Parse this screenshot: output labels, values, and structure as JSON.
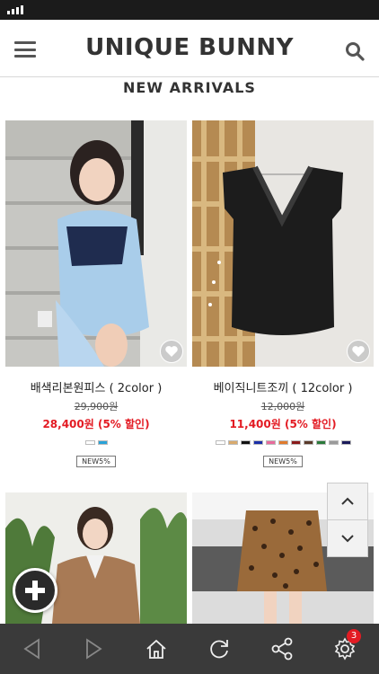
{
  "header": {
    "brand": "UNIQUE BUNNY"
  },
  "section": {
    "title": "NEW ARRIVALS"
  },
  "products": [
    {
      "name": "배색리본원피스 ( 2color )",
      "old_price": "29,900원",
      "new_price": "28,400원 (5% 할인)",
      "badge": "NEW5%",
      "swatches": [
        "#ffffff",
        "#29a3d8"
      ]
    },
    {
      "name": "베이직니트조끼 ( 12color )",
      "old_price": "12,000원",
      "new_price": "11,400원 (5% 할인)",
      "badge": "NEW5%",
      "swatches": [
        "#ffffff",
        "#d9ab6e",
        "#111111",
        "#1a2fa8",
        "#e86b9c",
        "#e07b2e",
        "#8a1a1a",
        "#5a3a2a",
        "#2a7a3a",
        "#9a9a9a",
        "#1a1a5a"
      ]
    },
    {
      "name": "",
      "old_price": "",
      "new_price": "",
      "badge": ""
    },
    {
      "name": "",
      "old_price": "",
      "new_price": "",
      "badge": ""
    }
  ],
  "bottom_bar": {
    "notification_count": "3"
  },
  "colors": {
    "sale_red": "#e31b23",
    "bar_dark": "#3a3a3a",
    "status_bar": "#1b1b1b"
  }
}
